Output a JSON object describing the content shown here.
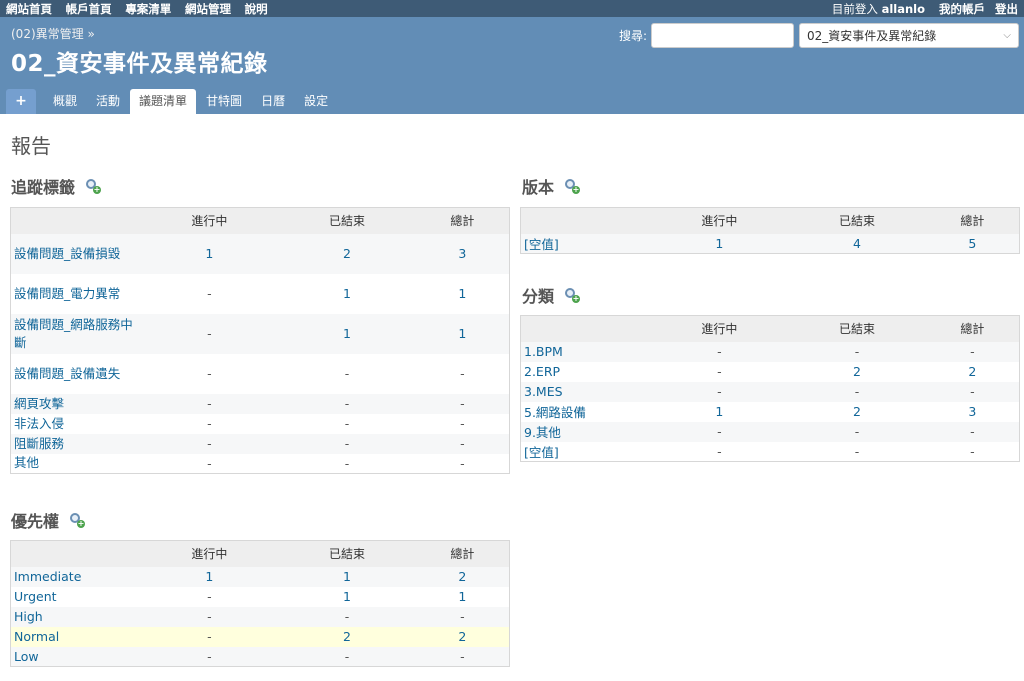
{
  "top_menu": {
    "left": [
      "網站首頁",
      "帳戶首頁",
      "專案清單",
      "網站管理",
      "說明"
    ],
    "logged_as_prefix": "目前登入",
    "username": "allanlo",
    "my_account": "我的帳戶",
    "logout": "登出"
  },
  "header": {
    "breadcrumb": "(02)異常管理 »",
    "title": "02_資安事件及異常紀錄",
    "search_label": "搜尋:",
    "search_placeholder": "",
    "project_jump": "02_資安事件及異常紀錄",
    "tabs": [
      {
        "label": "+",
        "type": "new"
      },
      {
        "label": "概觀"
      },
      {
        "label": "活動"
      },
      {
        "label": "議題清單",
        "selected": true
      },
      {
        "label": "甘特圖"
      },
      {
        "label": "日曆"
      },
      {
        "label": "設定"
      }
    ]
  },
  "page_title": "報告",
  "columns": {
    "open": "進行中",
    "closed": "已結束",
    "total": "總計"
  },
  "tracker": {
    "title": "追蹤標籤",
    "rows": [
      {
        "name": "設備問題_設備損毀",
        "open": "1",
        "closed": "2",
        "total": "3"
      },
      {
        "name": "設備問題_電力異常",
        "open": "-",
        "closed": "1",
        "total": "1"
      },
      {
        "name": "設備問題_網路服務中斷",
        "open": "-",
        "closed": "1",
        "total": "1"
      },
      {
        "name": "設備問題_設備遺失",
        "open": "-",
        "closed": "-",
        "total": "-"
      },
      {
        "name": "網頁攻擊",
        "open": "-",
        "closed": "-",
        "total": "-"
      },
      {
        "name": "非法入侵",
        "open": "-",
        "closed": "-",
        "total": "-"
      },
      {
        "name": "阻斷服務",
        "open": "-",
        "closed": "-",
        "total": "-"
      },
      {
        "name": "其他",
        "open": "-",
        "closed": "-",
        "total": "-"
      }
    ]
  },
  "priority": {
    "title": "優先權",
    "rows": [
      {
        "name": "Immediate",
        "open": "1",
        "closed": "1",
        "total": "2"
      },
      {
        "name": "Urgent",
        "open": "-",
        "closed": "1",
        "total": "1"
      },
      {
        "name": "High",
        "open": "-",
        "closed": "-",
        "total": "-"
      },
      {
        "name": "Normal",
        "open": "-",
        "closed": "2",
        "total": "2"
      },
      {
        "name": "Low",
        "open": "-",
        "closed": "-",
        "total": "-"
      }
    ]
  },
  "version": {
    "title": "版本",
    "rows": [
      {
        "name": "[空值]",
        "open": "1",
        "closed": "4",
        "total": "5"
      }
    ]
  },
  "category": {
    "title": "分類",
    "rows": [
      {
        "name": "1.BPM",
        "open": "-",
        "closed": "-",
        "total": "-"
      },
      {
        "name": "2.ERP",
        "open": "-",
        "closed": "2",
        "total": "2"
      },
      {
        "name": "3.MES",
        "open": "-",
        "closed": "-",
        "total": "-"
      },
      {
        "name": "5.網路設備",
        "open": "1",
        "closed": "2",
        "total": "3"
      },
      {
        "name": "9.其他",
        "open": "-",
        "closed": "-",
        "total": "-"
      },
      {
        "name": "[空值]",
        "open": "-",
        "closed": "-",
        "total": "-"
      }
    ]
  }
}
